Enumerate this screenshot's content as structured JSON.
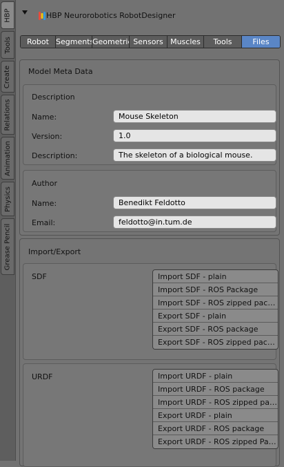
{
  "side_tabs": [
    "HBP",
    "Tools",
    "Create",
    "Relations",
    "Animation",
    "Physics",
    "Grease Pencil"
  ],
  "header": {
    "title": "HBP Neurorobotics RobotDesigner"
  },
  "tabs": [
    {
      "label": "Robot",
      "active": false
    },
    {
      "label": "Segments",
      "active": false
    },
    {
      "label": "Geometrie",
      "active": false
    },
    {
      "label": "Sensors",
      "active": false
    },
    {
      "label": "Muscles",
      "active": false
    },
    {
      "label": "Tools",
      "active": false
    },
    {
      "label": "Files",
      "active": true
    }
  ],
  "meta": {
    "title": "Model Meta Data",
    "description_section": {
      "title": "Description",
      "name_label": "Name:",
      "name_value": "Mouse Skeleton",
      "version_label": "Version:",
      "version_value": "1.0",
      "desc_label": "Description:",
      "desc_value": "The skeleton of a biological mouse."
    },
    "author_section": {
      "title": "Author",
      "name_label": "Name:",
      "name_value": "Benedikt Feldotto",
      "email_label": "Email:",
      "email_value": "feldotto@in.tum.de"
    }
  },
  "import_export": {
    "title": "Import/Export",
    "sdf": {
      "label": "SDF",
      "buttons": [
        "Import SDF - plain",
        "Import SDF - ROS Package",
        "Import SDF - ROS zipped package",
        "Export SDF - plain",
        "Export SDF - ROS package",
        "Export SDF - ROS zipped package"
      ]
    },
    "urdf": {
      "label": "URDF",
      "buttons": [
        "Import URDF - plain",
        "Import URDF - ROS package",
        "Import URDF - ROS zipped pack...",
        "Export URDF - plain",
        "Export URDF - ROS package",
        "Export URDF - ROS zipped Pack..."
      ]
    }
  },
  "colors": {
    "active_tab": "#5a86c6",
    "background": "#727272",
    "field_bg": "#e5e5e5"
  }
}
